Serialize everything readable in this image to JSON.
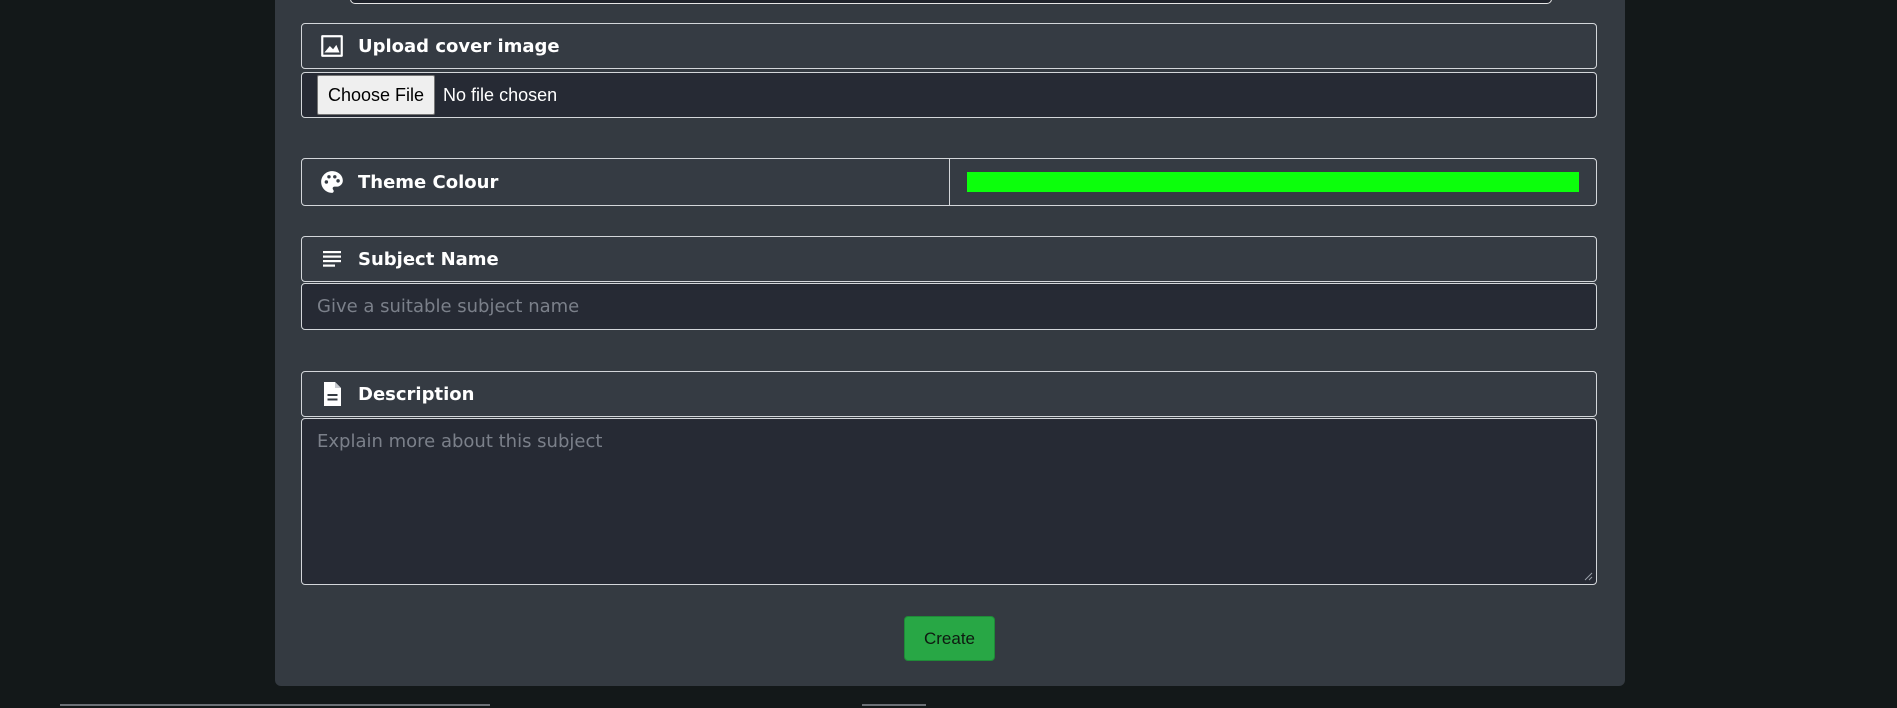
{
  "cover_image": {
    "label": "Upload cover image",
    "icon": "image-icon",
    "choose_button": "Choose File",
    "status": "No file chosen"
  },
  "theme": {
    "label": "Theme Colour",
    "icon": "palette-icon",
    "value": "#0cff0c"
  },
  "subject_name": {
    "label": "Subject Name",
    "icon": "lines-icon",
    "placeholder": "Give a suitable subject name"
  },
  "description": {
    "label": "Description",
    "icon": "document-icon",
    "placeholder": "Explain more about this subject"
  },
  "actions": {
    "create": "Create"
  }
}
